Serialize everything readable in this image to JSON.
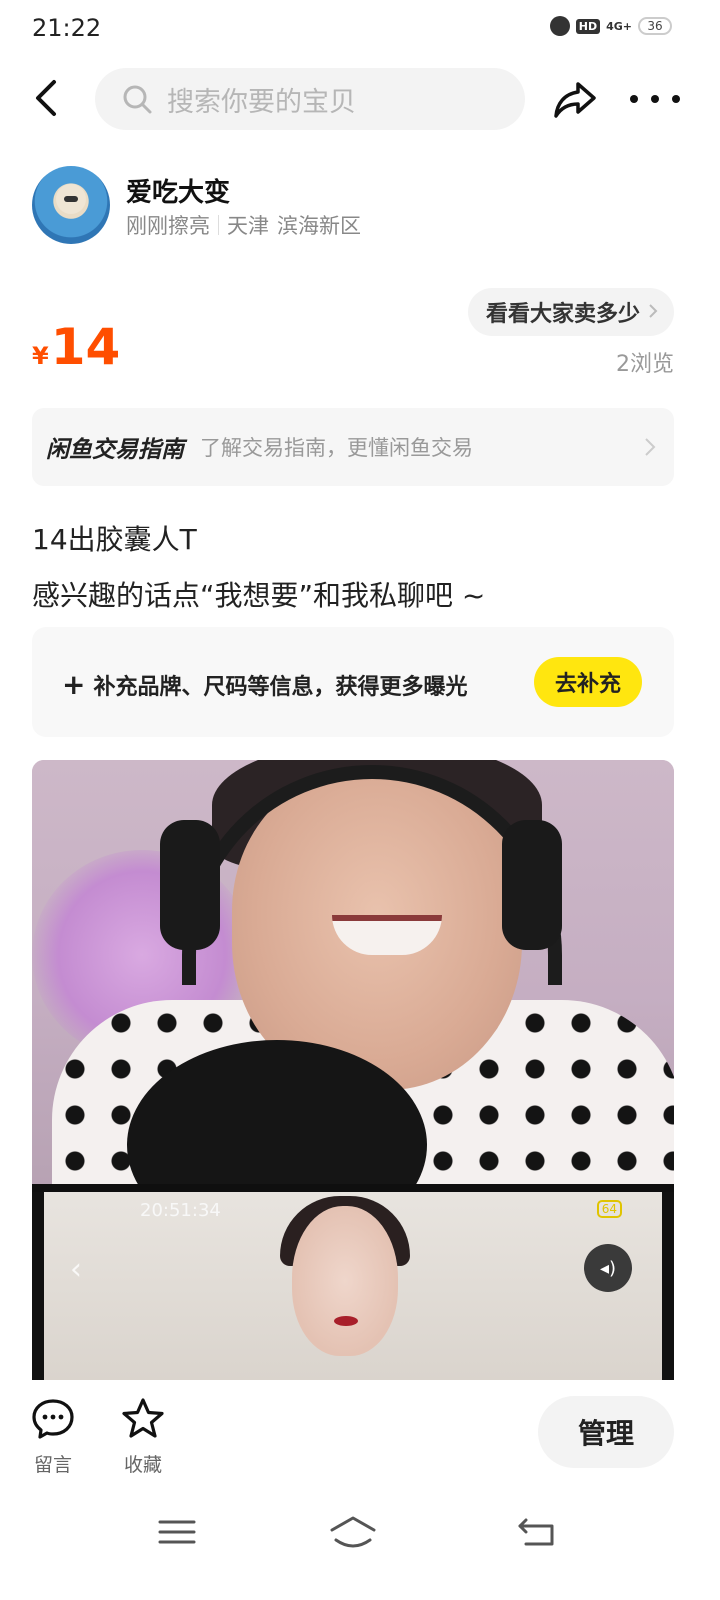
{
  "status_bar": {
    "time": "21:22",
    "hd": "HD",
    "network": "4G+",
    "battery": "36"
  },
  "search": {
    "placeholder": "搜索你要的宝贝"
  },
  "seller": {
    "name": "爱吃大变",
    "activity": "刚刚擦亮",
    "city": "天津",
    "district": "滨海新区"
  },
  "price": {
    "symbol": "¥",
    "value": "14"
  },
  "compare_label": "看看大家卖多少",
  "views": "2浏览",
  "guide": {
    "title": "闲鱼交易指南",
    "desc": "了解交易指南，更懂闲鱼交易"
  },
  "description": {
    "line1": "14出胶囊人T",
    "line2": "感兴趣的话点“我想要”和我私聊吧 ~"
  },
  "supplement": {
    "plus": "+",
    "text": "补充品牌、尺码等信息，获得更多曝光",
    "button": "去补充"
  },
  "image_overlay": {
    "phone_time": "20:51:34",
    "phone_battery": "64"
  },
  "actions": {
    "comment": "留言",
    "favorite": "收藏",
    "manage": "管理"
  },
  "colors": {
    "price": "#ff4e00",
    "accent_button": "#ffe60f"
  }
}
